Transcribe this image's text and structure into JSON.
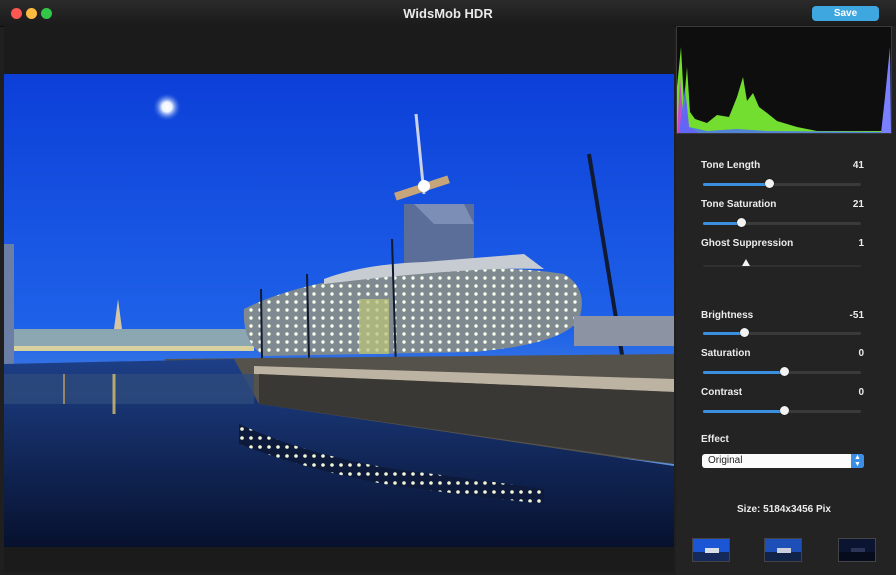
{
  "window": {
    "title": "WidsMob HDR"
  },
  "toolbar": {
    "save_label": "Save"
  },
  "controls": {
    "tone_length": {
      "label": "Tone Length",
      "value": "41",
      "level": 0.42
    },
    "tone_saturation": {
      "label": "Tone Saturation",
      "value": "21",
      "level": 0.24
    },
    "ghost_suppression": {
      "label": "Ghost Suppression",
      "value": "1",
      "level": 0.27
    },
    "brightness": {
      "label": "Brightness",
      "value": "-51",
      "level": 0.26
    },
    "saturation": {
      "label": "Saturation",
      "value": "0",
      "level": 0.51
    },
    "contrast": {
      "label": "Contrast",
      "value": "0",
      "level": 0.51
    }
  },
  "effect": {
    "label": "Effect",
    "selected": "Original"
  },
  "image_info": {
    "size_text": "Size: 5184x3456 Pix"
  },
  "icons": {
    "effect_select_arrow": "up-down-chevron-icon"
  },
  "colors": {
    "accent": "#3b8fe0",
    "save_button": "#3fa7e0",
    "panel_bg": "#232323"
  }
}
